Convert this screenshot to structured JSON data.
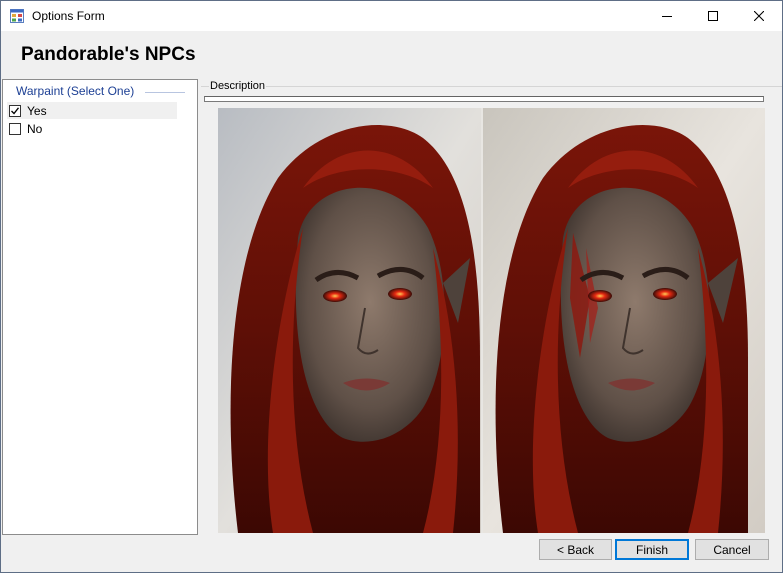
{
  "window": {
    "title": "Options Form",
    "icons": {
      "app": "app-form-icon",
      "minimize": "minimize-icon",
      "maximize": "maximize-icon",
      "close": "close-icon"
    }
  },
  "header": {
    "title": "Pandorable's NPCs"
  },
  "options": {
    "group_label": "Warpaint (Select One)",
    "items": [
      {
        "label": "Yes",
        "checked": true,
        "selected": true
      },
      {
        "label": "No",
        "checked": false,
        "selected": false
      }
    ]
  },
  "description": {
    "label": "Description",
    "text": ""
  },
  "preview": {
    "image": "side-by-side portrait: red-haired elf woman with red eyes, right version with red warpaint"
  },
  "buttons": {
    "back": "< Back",
    "finish": "Finish",
    "cancel": "Cancel"
  },
  "colors": {
    "accent": "#0078d7",
    "group_label": "#1c3f94",
    "hair": "#6e1208"
  }
}
